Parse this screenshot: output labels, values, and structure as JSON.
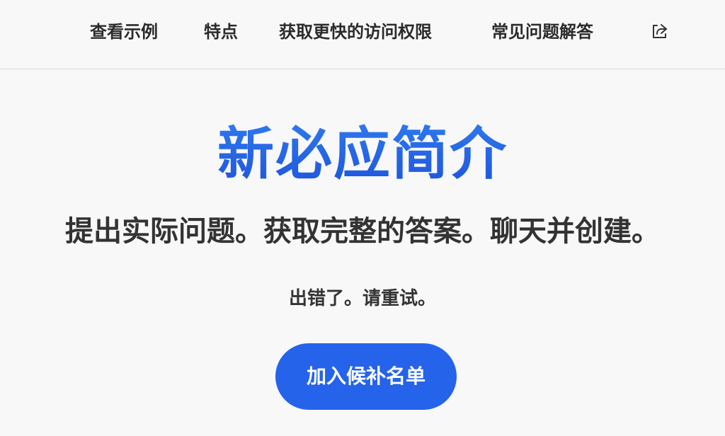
{
  "nav": {
    "items": [
      {
        "label": "查看示例"
      },
      {
        "label": "特点"
      },
      {
        "label": "获取更快的访问权限"
      },
      {
        "label": "常见问题解答"
      }
    ],
    "share_icon": "share-icon"
  },
  "hero": {
    "title": "新必应简介",
    "tagline": "提出实际问题。获取完整的答案。聊天并创建。",
    "error_message": "出错了。请重试。",
    "cta_label": "加入候补名单",
    "accent_color": "#2563eb"
  }
}
